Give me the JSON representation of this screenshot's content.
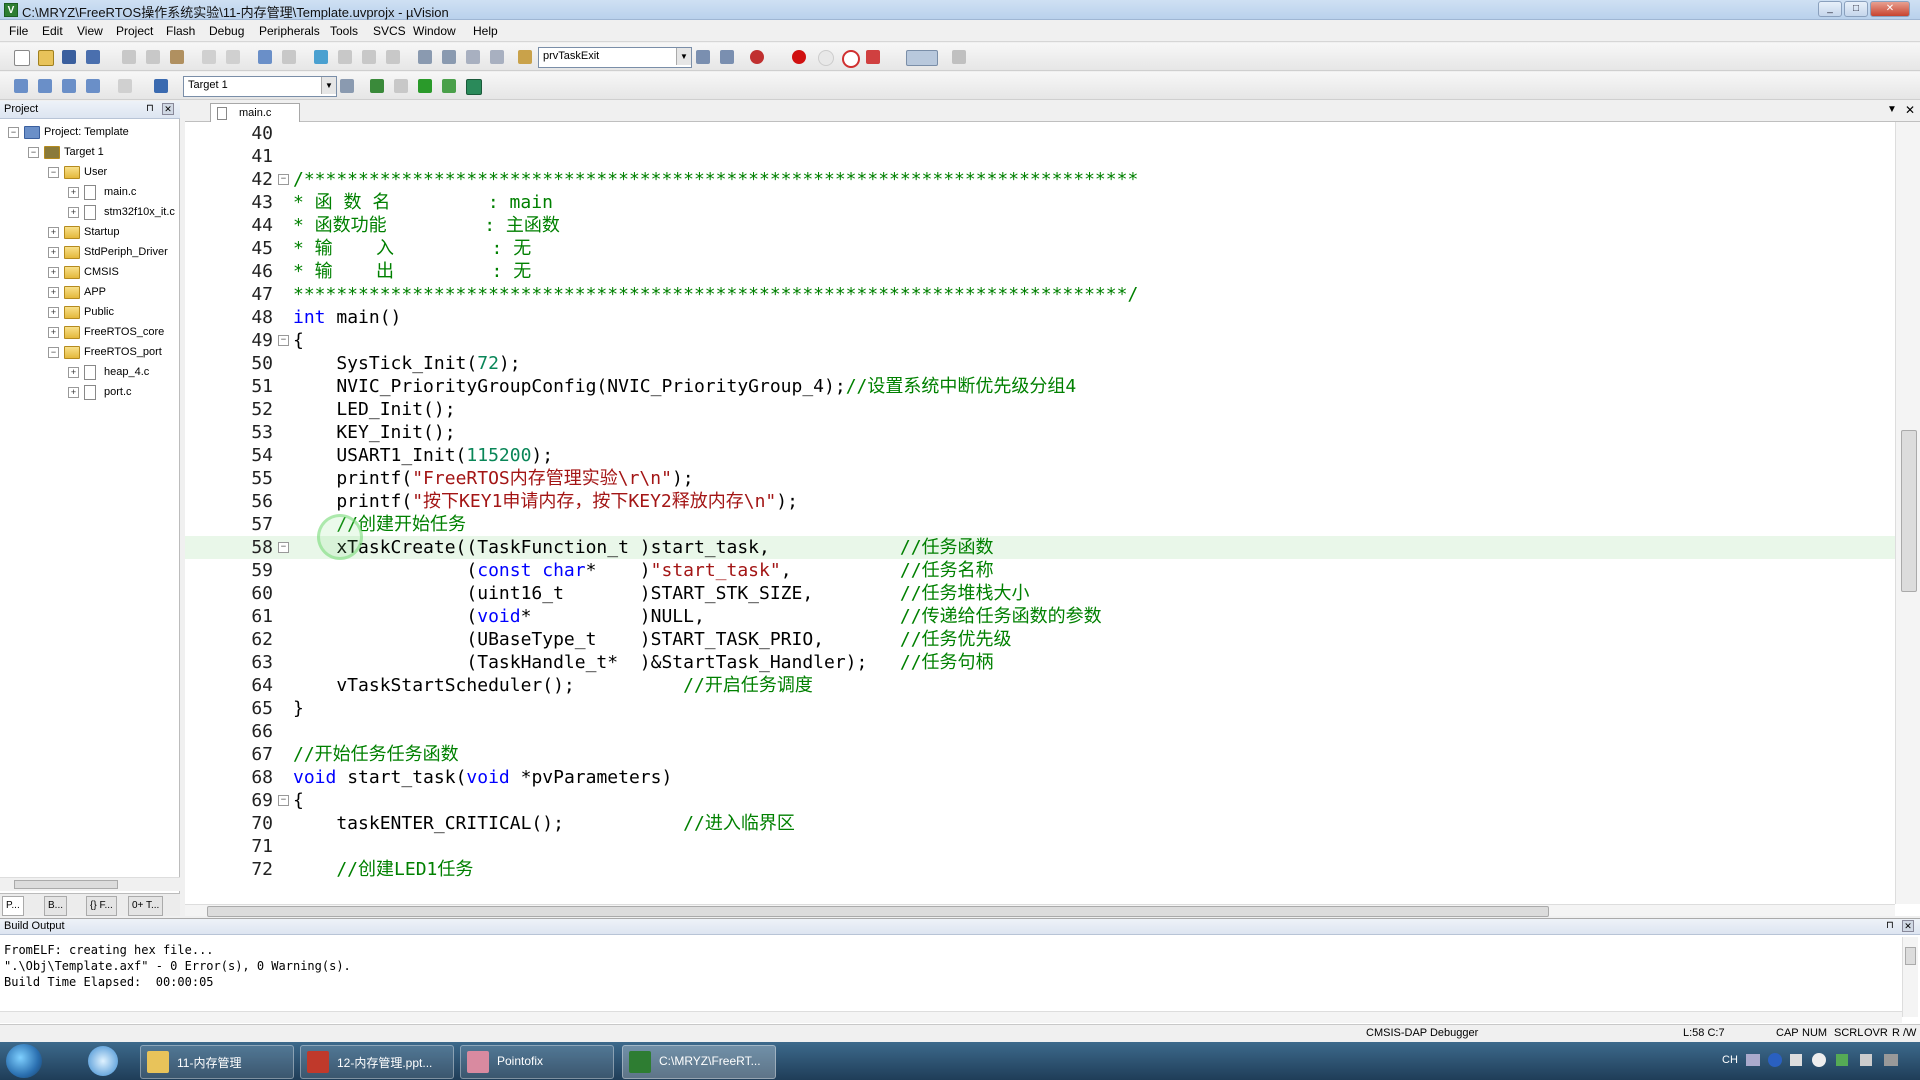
{
  "window": {
    "title": "C:\\MRYZ\\FreeRTOS操作系统实验\\11-内存管理\\Template.uvprojx - µVision"
  },
  "menubar": [
    "File",
    "Edit",
    "View",
    "Project",
    "Flash",
    "Debug",
    "Peripherals",
    "Tools",
    "SVCS",
    "Window",
    "Help"
  ],
  "toolbar1": {
    "function_combo": "prvTaskExit"
  },
  "toolbar2": {
    "target_combo": "Target 1"
  },
  "project_panel": {
    "title": "Project",
    "tree": [
      {
        "label": "Project: Template",
        "depth": 0,
        "kind": "project",
        "exp": "-"
      },
      {
        "label": "Target 1",
        "depth": 1,
        "kind": "target",
        "exp": "-"
      },
      {
        "label": "User",
        "depth": 2,
        "kind": "folder",
        "exp": "-"
      },
      {
        "label": "main.c",
        "depth": 3,
        "kind": "file",
        "exp": "+"
      },
      {
        "label": "stm32f10x_it.c",
        "depth": 3,
        "kind": "file",
        "exp": "+"
      },
      {
        "label": "Startup",
        "depth": 2,
        "kind": "folder",
        "exp": "+"
      },
      {
        "label": "StdPeriph_Driver",
        "depth": 2,
        "kind": "folder",
        "exp": "+"
      },
      {
        "label": "CMSIS",
        "depth": 2,
        "kind": "folder",
        "exp": "+"
      },
      {
        "label": "APP",
        "depth": 2,
        "kind": "folder",
        "exp": "+"
      },
      {
        "label": "Public",
        "depth": 2,
        "kind": "folder",
        "exp": "+"
      },
      {
        "label": "FreeRTOS_core",
        "depth": 2,
        "kind": "folder",
        "exp": "+"
      },
      {
        "label": "FreeRTOS_port",
        "depth": 2,
        "kind": "folder",
        "exp": "-"
      },
      {
        "label": "heap_4.c",
        "depth": 3,
        "kind": "file",
        "exp": "+"
      },
      {
        "label": "port.c",
        "depth": 3,
        "kind": "file",
        "exp": "+"
      }
    ],
    "tabs": [
      "P...",
      "B...",
      "{} F...",
      "0+ T..."
    ]
  },
  "editor": {
    "active_tab": "main.c",
    "current_line": 58,
    "lines": [
      {
        "n": "40",
        "fold": "",
        "segs": []
      },
      {
        "n": "41",
        "fold": "",
        "segs": []
      },
      {
        "n": "42",
        "fold": "-",
        "segs": [
          {
            "c": "com",
            "t": "/*****************************************************************************"
          }
        ]
      },
      {
        "n": "43",
        "fold": "",
        "segs": [
          {
            "c": "com",
            "t": "* 函 数 名         : main"
          }
        ]
      },
      {
        "n": "44",
        "fold": "",
        "segs": [
          {
            "c": "com",
            "t": "* 函数功能         : 主函数"
          }
        ]
      },
      {
        "n": "45",
        "fold": "",
        "segs": [
          {
            "c": "com",
            "t": "* 输    入         : 无"
          }
        ]
      },
      {
        "n": "46",
        "fold": "",
        "segs": [
          {
            "c": "com",
            "t": "* 输    出         : 无"
          }
        ]
      },
      {
        "n": "47",
        "fold": "",
        "segs": [
          {
            "c": "com",
            "t": "*****************************************************************************/"
          }
        ]
      },
      {
        "n": "48",
        "fold": "",
        "segs": [
          {
            "c": "kw",
            "t": "int"
          },
          {
            "c": "pl",
            "t": " main()"
          }
        ]
      },
      {
        "n": "49",
        "fold": "-",
        "segs": [
          {
            "c": "pl",
            "t": "{"
          }
        ]
      },
      {
        "n": "50",
        "fold": "",
        "segs": [
          {
            "c": "pl",
            "t": "    SysTick_Init("
          },
          {
            "c": "num",
            "t": "72"
          },
          {
            "c": "pl",
            "t": ");"
          }
        ]
      },
      {
        "n": "51",
        "fold": "",
        "segs": [
          {
            "c": "pl",
            "t": "    NVIC_PriorityGroupConfig(NVIC_PriorityGroup_4);"
          },
          {
            "c": "com",
            "t": "//设置系统中断优先级分组4"
          }
        ]
      },
      {
        "n": "52",
        "fold": "",
        "segs": [
          {
            "c": "pl",
            "t": "    LED_Init();"
          }
        ]
      },
      {
        "n": "53",
        "fold": "",
        "segs": [
          {
            "c": "pl",
            "t": "    KEY_Init();"
          }
        ]
      },
      {
        "n": "54",
        "fold": "",
        "segs": [
          {
            "c": "pl",
            "t": "    USART1_Init("
          },
          {
            "c": "num",
            "t": "115200"
          },
          {
            "c": "pl",
            "t": ");"
          }
        ]
      },
      {
        "n": "55",
        "fold": "",
        "segs": [
          {
            "c": "pl",
            "t": "    printf("
          },
          {
            "c": "str",
            "t": "\"FreeRTOS内存管理实验\\r\\n\""
          },
          {
            "c": "pl",
            "t": ");"
          }
        ]
      },
      {
        "n": "56",
        "fold": "",
        "segs": [
          {
            "c": "pl",
            "t": "    printf("
          },
          {
            "c": "str",
            "t": "\"按下KEY1申请内存，按下KEY2释放内存\\n\""
          },
          {
            "c": "pl",
            "t": ");"
          }
        ]
      },
      {
        "n": "57",
        "fold": "",
        "segs": [
          {
            "c": "com",
            "t": "    //创建开始任务"
          }
        ]
      },
      {
        "n": "58",
        "fold": "-",
        "segs": [
          {
            "c": "pl",
            "t": "    xTaskCreate((TaskFunction_t )start_task,            "
          },
          {
            "c": "com",
            "t": "//任务函数"
          }
        ]
      },
      {
        "n": "59",
        "fold": "",
        "segs": [
          {
            "c": "pl",
            "t": "                ("
          },
          {
            "c": "kw",
            "t": "const char"
          },
          {
            "c": "pl",
            "t": "*    )"
          },
          {
            "c": "str",
            "t": "\"start_task\""
          },
          {
            "c": "pl",
            "t": ",          "
          },
          {
            "c": "com",
            "t": "//任务名称"
          }
        ]
      },
      {
        "n": "60",
        "fold": "",
        "segs": [
          {
            "c": "pl",
            "t": "                (uint16_t       )START_STK_SIZE,        "
          },
          {
            "c": "com",
            "t": "//任务堆栈大小"
          }
        ]
      },
      {
        "n": "61",
        "fold": "",
        "segs": [
          {
            "c": "pl",
            "t": "                ("
          },
          {
            "c": "kw",
            "t": "void"
          },
          {
            "c": "pl",
            "t": "*          )NULL,                  "
          },
          {
            "c": "com",
            "t": "//传递给任务函数的参数"
          }
        ]
      },
      {
        "n": "62",
        "fold": "",
        "segs": [
          {
            "c": "pl",
            "t": "                (UBaseType_t    )START_TASK_PRIO,       "
          },
          {
            "c": "com",
            "t": "//任务优先级"
          }
        ]
      },
      {
        "n": "63",
        "fold": "",
        "segs": [
          {
            "c": "pl",
            "t": "                (TaskHandle_t*  )&StartTask_Handler);   "
          },
          {
            "c": "com",
            "t": "//任务句柄"
          }
        ]
      },
      {
        "n": "64",
        "fold": "",
        "segs": [
          {
            "c": "pl",
            "t": "    vTaskStartScheduler();          "
          },
          {
            "c": "com",
            "t": "//开启任务调度"
          }
        ]
      },
      {
        "n": "65",
        "fold": "",
        "segs": [
          {
            "c": "pl",
            "t": "}"
          }
        ]
      },
      {
        "n": "66",
        "fold": "",
        "segs": []
      },
      {
        "n": "67",
        "fold": "",
        "segs": [
          {
            "c": "com",
            "t": "//开始任务任务函数"
          }
        ]
      },
      {
        "n": "68",
        "fold": "",
        "segs": [
          {
            "c": "kw",
            "t": "void"
          },
          {
            "c": "pl",
            "t": " start_task("
          },
          {
            "c": "kw",
            "t": "void"
          },
          {
            "c": "pl",
            "t": " *pvParameters)"
          }
        ]
      },
      {
        "n": "69",
        "fold": "-",
        "segs": [
          {
            "c": "pl",
            "t": "{"
          }
        ]
      },
      {
        "n": "70",
        "fold": "",
        "segs": [
          {
            "c": "pl",
            "t": "    taskENTER_CRITICAL();           "
          },
          {
            "c": "com",
            "t": "//进入临界区"
          }
        ]
      },
      {
        "n": "71",
        "fold": "",
        "segs": []
      },
      {
        "n": "72",
        "fold": "",
        "segs": [
          {
            "c": "com",
            "t": "    //创建LED1任务"
          }
        ]
      }
    ]
  },
  "build_output": {
    "title": "Build Output",
    "lines": [
      "FromELF: creating hex file...",
      "\".\\Obj\\Template.axf\" - 0 Error(s), 0 Warning(s).",
      "Build Time Elapsed:  00:00:05"
    ]
  },
  "statusbar": {
    "debugger": "CMSIS-DAP Debugger",
    "position": "L:58 C:7",
    "indicators": [
      "CAP",
      "NUM",
      "SCRL",
      "OVR",
      "R /W"
    ]
  },
  "taskbar": {
    "items": [
      {
        "label": "11-内存管理",
        "icon_color": "#e8c35a"
      },
      {
        "label": "12-内存管理.ppt...",
        "icon_color": "#c0392b"
      },
      {
        "label": "Pointofix",
        "icon_color": "#d98aa0"
      },
      {
        "label": "C:\\MRYZ\\FreeRT...",
        "icon_color": "#2e7d32"
      }
    ],
    "tray": {
      "lang": "CH"
    }
  },
  "colors": {
    "comment": "#008000",
    "keyword": "#0000ff",
    "string": "#a31515",
    "number": "#098658",
    "current_line": "#e9f7e9"
  }
}
